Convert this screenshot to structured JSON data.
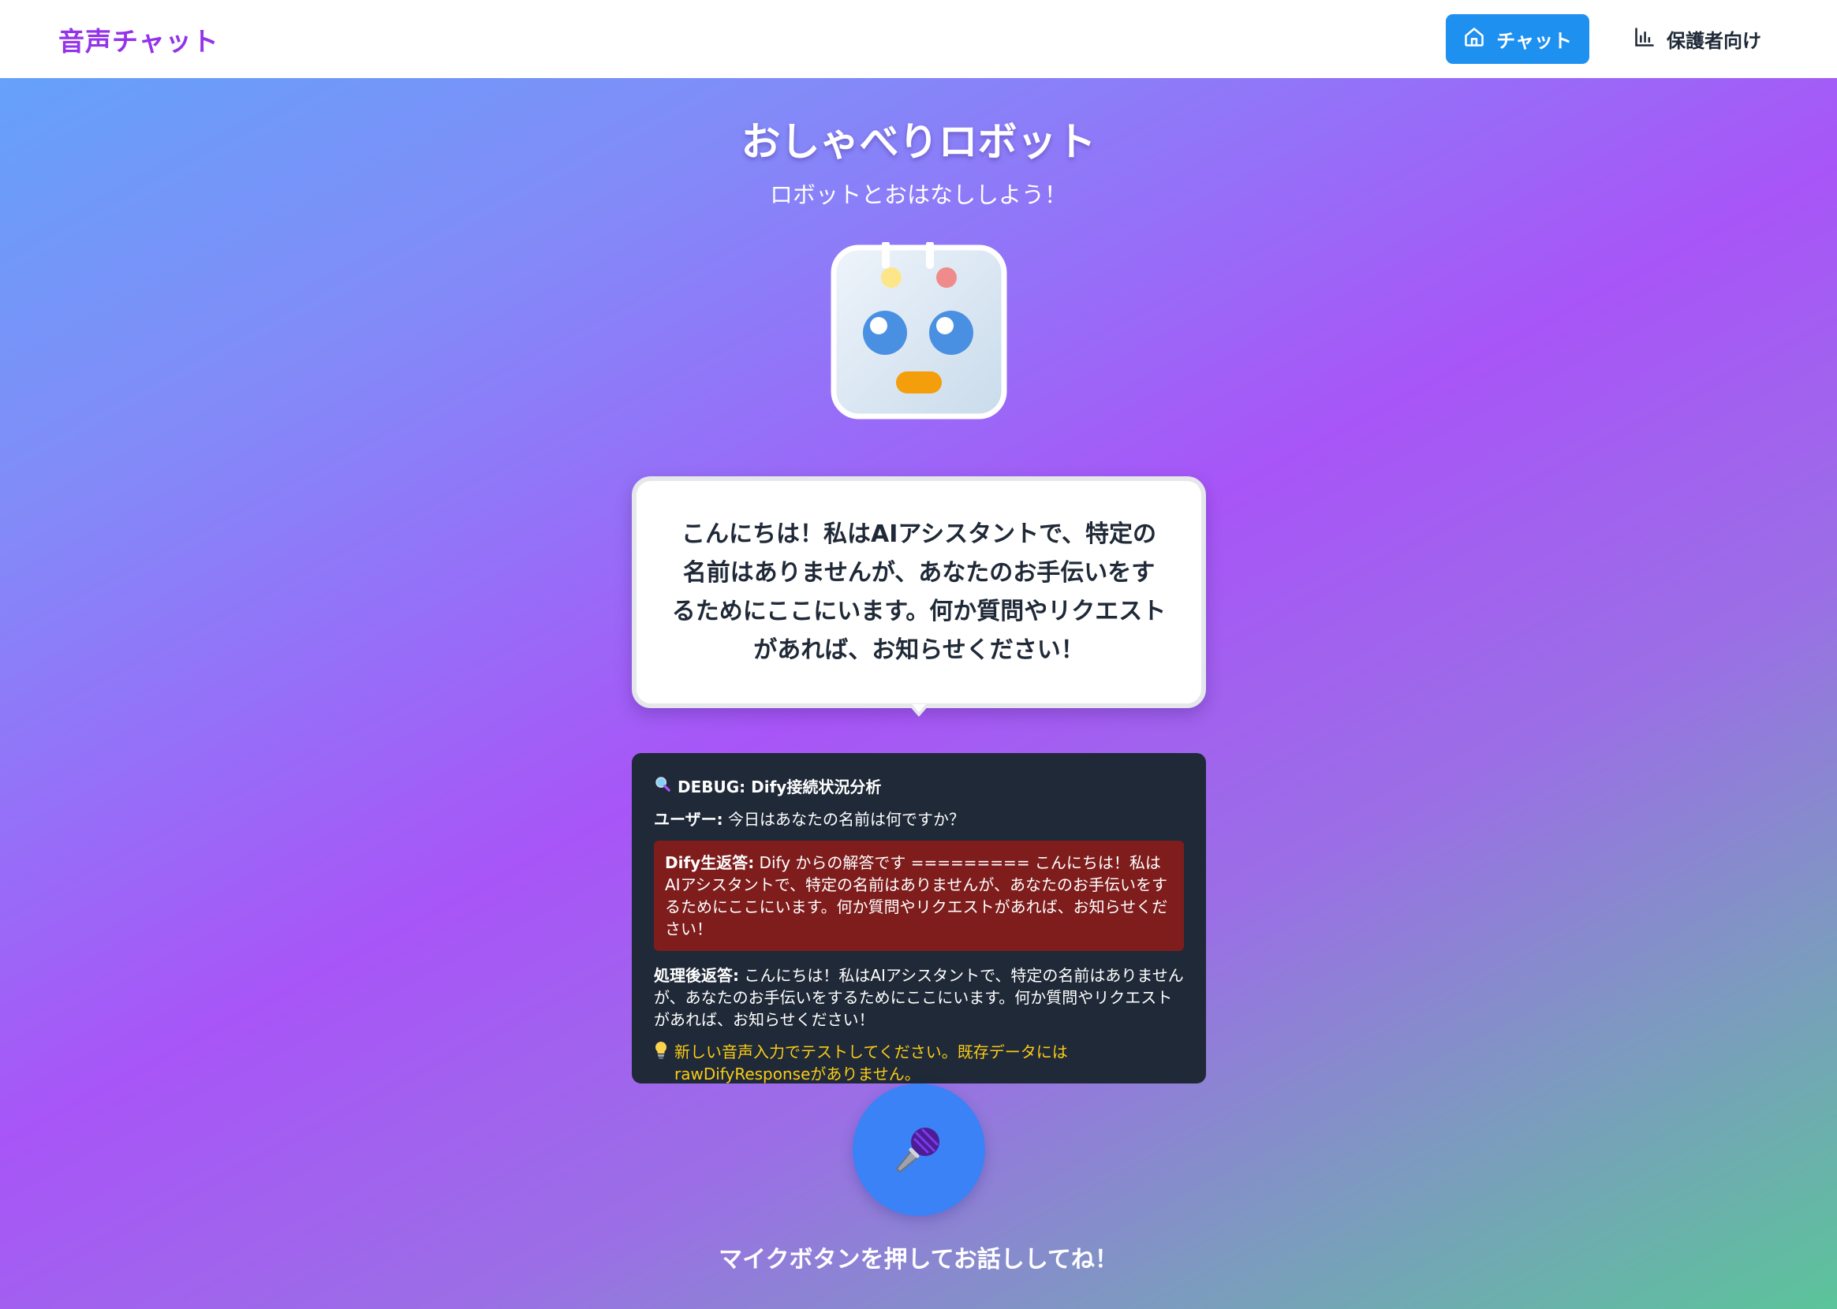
{
  "nav": {
    "brand": "音声チャット",
    "chat_label": "チャット",
    "parents_label": "保護者向け"
  },
  "hero": {
    "title": "おしゃべりロボット",
    "subtitle": "ロボットとおはなししよう！"
  },
  "bubble": {
    "message": "こんにちは！私はAIアシスタントで、特定の名前はありませんが、あなたのお手伝いをするためにここにいます。何か質問やリクエストがあれば、お知らせください！"
  },
  "debug": {
    "title": "DEBUG: Dify接続状況分析",
    "user_label": "ユーザー:",
    "user_text": " 今日はあなたの名前は何ですか？",
    "raw_label": "Dify生返答:",
    "raw_text": " Dify からの解答です ========= こんにちは！私はAIアシスタントで、特定の名前はありませんが、あなたのお手伝いをするためにここにいます。何か質問やリクエストがあれば、お知らせください！",
    "processed_label": "処理後返答:",
    "processed_text": " こんにちは！私はAIアシスタントで、特定の名前はありませんが、あなたのお手伝いをするためにここにいます。何か質問やリクエストがあれば、お知らせください！",
    "tip_text": "新しい音声入力でテストしてください。既存データにはrawDifyResponseがありません。"
  },
  "mic": {
    "hint": "マイクボタンを押してお話ししてね！"
  },
  "icons": {
    "home": "home-icon",
    "chart": "bar-chart-icon",
    "magnifier": "magnifier-icon",
    "bulb": "lightbulb-icon",
    "mic": "microphone-icon"
  },
  "colors": {
    "brand": "#9333ea",
    "nav_active": "#1e90f0",
    "debug_bg": "#1f2937",
    "raw_bg": "#7f1d1d",
    "tip": "#facc15",
    "mic_button": "#3b82f6"
  }
}
